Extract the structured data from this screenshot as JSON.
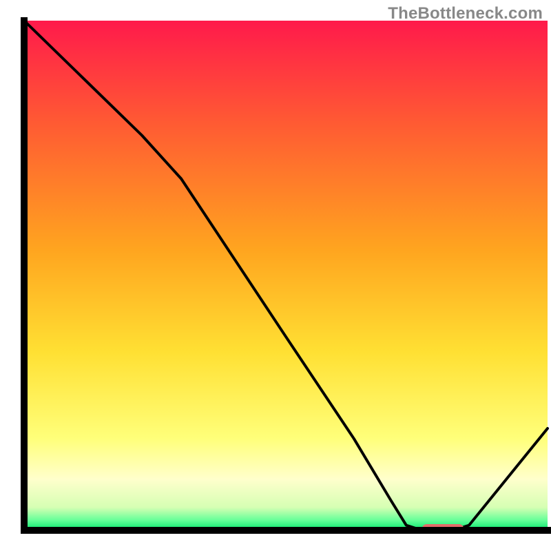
{
  "attribution": "TheBottleneck.com",
  "chart_data": {
    "type": "line",
    "title": "",
    "xlabel": "",
    "ylabel": "",
    "xlim": [
      0,
      100
    ],
    "ylim": [
      0,
      100
    ],
    "gradient_stops": [
      {
        "offset": 0.0,
        "color": "#ff1a4b"
      },
      {
        "offset": 0.2,
        "color": "#ff5a33"
      },
      {
        "offset": 0.45,
        "color": "#ffa51f"
      },
      {
        "offset": 0.65,
        "color": "#ffe033"
      },
      {
        "offset": 0.82,
        "color": "#ffff7a"
      },
      {
        "offset": 0.9,
        "color": "#ffffcc"
      },
      {
        "offset": 0.955,
        "color": "#d6ffb3"
      },
      {
        "offset": 0.98,
        "color": "#66ff99"
      },
      {
        "offset": 1.0,
        "color": "#00e56b"
      }
    ],
    "curve_points": [
      {
        "x": 0.0,
        "y": 100.0
      },
      {
        "x": 10.0,
        "y": 90.0
      },
      {
        "x": 22.5,
        "y": 77.5
      },
      {
        "x": 30.0,
        "y": 69.0
      },
      {
        "x": 50.0,
        "y": 38.0
      },
      {
        "x": 63.0,
        "y": 18.0
      },
      {
        "x": 70.0,
        "y": 6.0
      },
      {
        "x": 73.0,
        "y": 1.0
      },
      {
        "x": 76.0,
        "y": 0.0
      },
      {
        "x": 82.0,
        "y": 0.0
      },
      {
        "x": 85.0,
        "y": 1.0
      },
      {
        "x": 100.0,
        "y": 20.0
      }
    ],
    "marker": {
      "x_start": 76.0,
      "x_end": 84.0,
      "y": 0.0,
      "color": "#e46a6a"
    },
    "plot_background": "#ffffff",
    "axis_color": "#000000"
  }
}
